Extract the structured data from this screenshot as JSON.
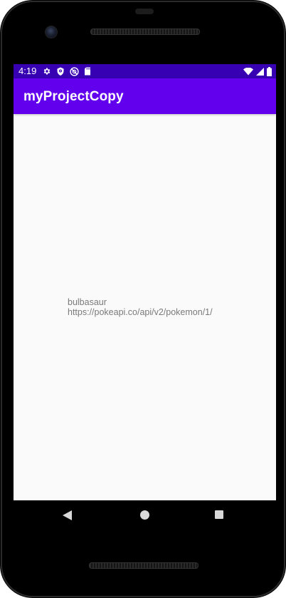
{
  "status_bar": {
    "time": "4:19",
    "background_color": "#3700b3",
    "left_icons": [
      "settings-gear-icon",
      "shield-icon",
      "no-sync-icon",
      "sd-card-icon"
    ],
    "right_icons": [
      "wifi-icon",
      "cellular-signal-icon",
      "battery-icon"
    ]
  },
  "app_bar": {
    "title": "myProjectCopy",
    "background_color": "#6200ee"
  },
  "content": {
    "items": [
      {
        "name": "bulbasaur",
        "url": "https://pokeapi.co/api/v2/pokemon/1/"
      }
    ]
  },
  "nav_bar": {
    "buttons": [
      "back-icon",
      "home-icon",
      "recents-icon"
    ]
  }
}
